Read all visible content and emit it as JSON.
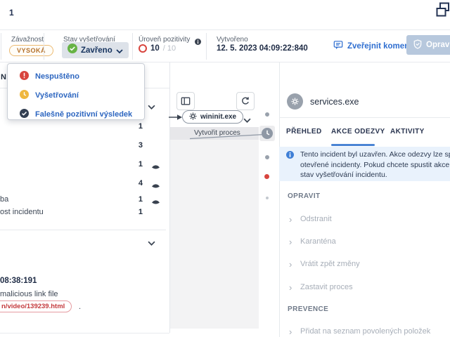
{
  "top_bar": {
    "count": "1"
  },
  "header": {
    "severity": {
      "label": "Závažnost",
      "value": "VYSOKÁ"
    },
    "investigation_status": {
      "label": "Stav vyšetřování",
      "value": "Zavřeno"
    },
    "positivity": {
      "label": "Úroveň pozitivity",
      "value": "10",
      "max": "/ 10"
    },
    "created": {
      "label": "Vytvořeno",
      "value": "12. 5. 2023 04:09:22:840"
    },
    "publish_comment_label": "Zveřejnit komentář",
    "remediate_label": "Opravit"
  },
  "status_dropdown": {
    "items": [
      {
        "label": "Nespuštěno"
      },
      {
        "label": "Vyšetřování"
      },
      {
        "label": "Falešně pozitivní výsledek"
      }
    ]
  },
  "left_panel": {
    "header_fragment": "N",
    "rows": [
      {
        "label": "",
        "count": "1"
      },
      {
        "label": "",
        "count": "3"
      },
      {
        "label": "",
        "count": "1"
      },
      {
        "label": "",
        "count": "4"
      },
      {
        "label": "ba",
        "count": "1"
      },
      {
        "label": "ost incidentu",
        "count": "1"
      }
    ],
    "detail": {
      "timestamp": "08:38:191",
      "description": "malicious link file",
      "link_badge": "n/video/139239.html",
      "after_badge": "."
    }
  },
  "graph_panel": {
    "node_label": "wininit.exe",
    "edge_label": "Vytvořit proces"
  },
  "right_panel": {
    "title": "services.exe",
    "tabs": [
      {
        "label": "PŘEHLED"
      },
      {
        "label": "AKCE ODEZVY"
      },
      {
        "label": "AKTIVITY"
      }
    ],
    "banner_lines": [
      "Tento incident byl uzavřen. Akce odezvy lze spusti",
      "otevřené incidenty. Pokud chcete spustit akce ode",
      "stav vyšetřování incidentu."
    ],
    "sections": [
      {
        "title": "OPRAVIT",
        "items": [
          "Odstranit",
          "Karanténa",
          "Vrátit zpět změny",
          "Zastavit proces"
        ]
      },
      {
        "title": "PREVENCE",
        "items": [
          "Přidat na seznam povolených položek"
        ]
      }
    ]
  },
  "colors": {
    "severity_orange": "#b4702a",
    "status_green": "#67b345",
    "alert_red": "#d8453e",
    "progress_amber": "#efb73e",
    "navy": "#232e3f",
    "link_blue": "#2e6ed0",
    "banner_blue_bg": "#e9f2fc",
    "active_tab_blue": "#4a84d4",
    "disabled_gray": "#a7aeb8"
  }
}
